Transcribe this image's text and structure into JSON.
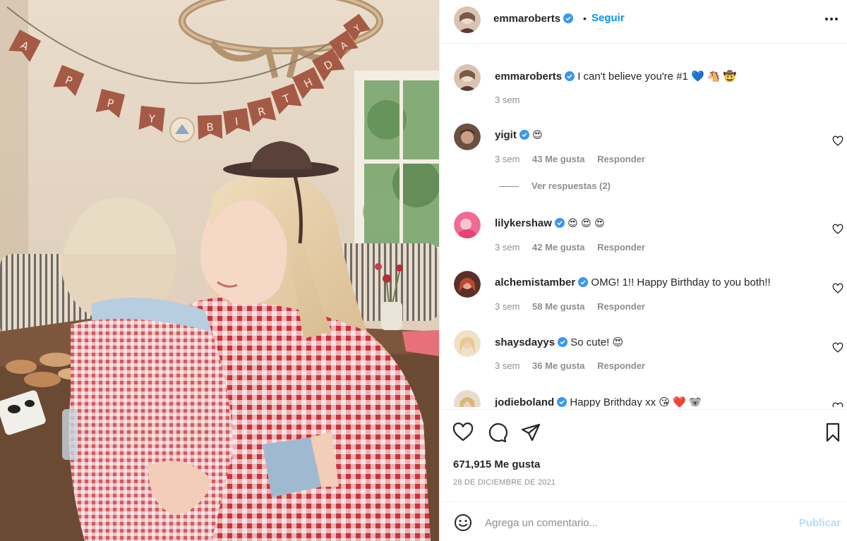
{
  "post": {
    "author": "emmaroberts",
    "follow_label": "Seguir",
    "separator": "•",
    "more_icon": "more-horizontal-icon"
  },
  "caption": {
    "username": "emmaroberts",
    "text": "I can't believe you're #1 💙 🐴 🤠",
    "time": "3 sem"
  },
  "comments": [
    {
      "username": "yigit",
      "text": "😍",
      "time": "3 sem",
      "likes": "43 Me gusta",
      "reply": "Responder"
    },
    {
      "username": "lilykershaw",
      "text": "😍 😍 😍",
      "time": "3 sem",
      "likes": "42 Me gusta",
      "reply": "Responder"
    },
    {
      "username": "alchemistamber",
      "text": "OMG! 1!! Happy Birthday to you both!!",
      "time": "3 sem",
      "likes": "58 Me gusta",
      "reply": "Responder"
    },
    {
      "username": "shaysdayys",
      "text": "So cute! 😍",
      "time": "3 sem",
      "likes": "36 Me gusta",
      "reply": "Responder"
    },
    {
      "username": "jodieboland",
      "text": "Happy Brithday xx 😘 ❤️ 🐨"
    }
  ],
  "view_replies": "Ver respuestas (2)",
  "actions": {
    "likes_count": "671,915 Me gusta",
    "date": "28 DE DICIEMBRE DE 2021"
  },
  "composer": {
    "placeholder": "Agrega un comentario...",
    "publish_label": "Publicar"
  },
  "photo": {
    "banner": [
      "A",
      "P",
      "P",
      "Y",
      "B",
      "I",
      "R",
      "T",
      "H",
      "D",
      "A",
      "Y"
    ]
  },
  "colors": {
    "accent": "#0095f6",
    "publish_disabled": "#b3dbff",
    "muted": "#8e8e8e",
    "verified": "#3897f0"
  }
}
